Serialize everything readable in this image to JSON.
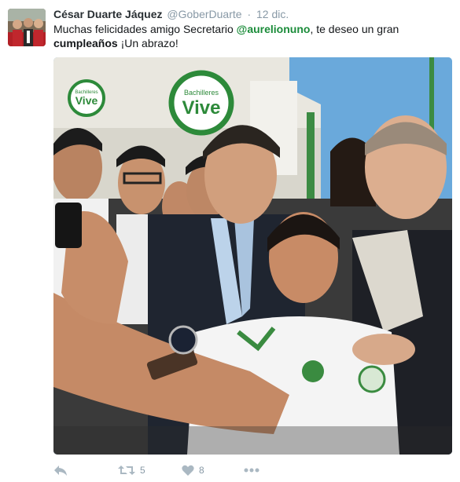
{
  "tweet": {
    "author_name": "César Duarte Jáquez",
    "author_handle": "@GoberDuarte",
    "separator": "·",
    "date": "12 dic.",
    "text_part1": "Muchas felicidades amigo Secretario ",
    "mention": "@aurelionuno",
    "text_part2": ", te deseo un gran ",
    "bold_word": "cumpleaños",
    "text_part3": " ¡Un abrazo!"
  },
  "photo": {
    "sign_left": "Vive",
    "sign_left_small": "Bachilleres",
    "sign_center": "Vive",
    "sign_center_small": "Bachilleres"
  },
  "actions": {
    "retweet_count": "5",
    "like_count": "8"
  },
  "colors": {
    "mention": "#1b8c3a",
    "muted": "#8899a6",
    "icon": "#aab8c2",
    "sign_green": "#2d8a3a"
  },
  "icons": [
    "reply-icon",
    "retweet-icon",
    "heart-icon",
    "more-icon"
  ]
}
